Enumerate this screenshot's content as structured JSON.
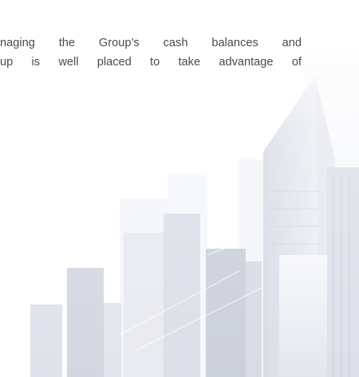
{
  "document": {
    "paragraph_lines": [
      "naging the Group’s cash balances and",
      "up is well placed to take advantage of"
    ]
  },
  "illustration": {
    "name": "city-skyline-watermark",
    "colors": {
      "light": "#eef0f5",
      "mid": "#dfe2ea",
      "dark": "#c9ccd8",
      "shadow": "#b8bccb"
    }
  }
}
